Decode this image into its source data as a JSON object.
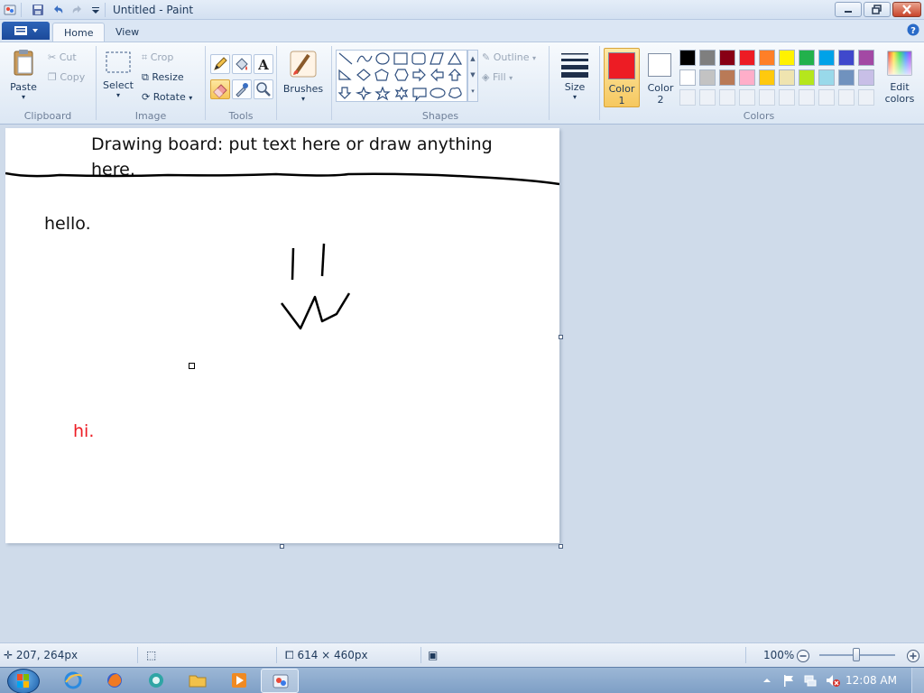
{
  "window": {
    "title": "Untitled - Paint"
  },
  "tabs": [
    {
      "label": "Home",
      "active": true
    },
    {
      "label": "View",
      "active": false
    }
  ],
  "ribbon": {
    "clipboard": {
      "label": "Clipboard",
      "paste": "Paste",
      "cut": "Cut",
      "copy": "Copy"
    },
    "image": {
      "label": "Image",
      "select": "Select",
      "crop": "Crop",
      "resize": "Resize",
      "rotate": "Rotate"
    },
    "tools": {
      "label": "Tools",
      "items": [
        "pencil-icon",
        "fill-icon",
        "text-icon",
        "eraser-icon",
        "color-picker-icon",
        "magnifier-icon"
      ],
      "active": "eraser-icon"
    },
    "brushes": {
      "label": "Brushes"
    },
    "shapes": {
      "label": "Shapes",
      "outline": "Outline",
      "fill": "Fill"
    },
    "size": {
      "label": "Size"
    },
    "colors": {
      "label": "Colors",
      "color1_label_line1": "Color",
      "color1_label_line2": "1",
      "color2_label_line1": "Color",
      "color2_label_line2": "2",
      "color1": "#ed1c24",
      "color2": "#ffffff",
      "edit_line1": "Edit",
      "edit_line2": "colors",
      "palette_row1": [
        "#000000",
        "#7f7f7f",
        "#880015",
        "#ed1c24",
        "#ff7f27",
        "#fff200",
        "#22b14c",
        "#00a2e8",
        "#3f48cc",
        "#a349a4"
      ],
      "palette_row2": [
        "#ffffff",
        "#c3c3c3",
        "#b97a57",
        "#ffaec9",
        "#ffc90e",
        "#efe4b0",
        "#b5e61d",
        "#99d9ea",
        "#7092be",
        "#c8bfe7"
      ]
    }
  },
  "canvas": {
    "header_line1": "Drawing board: put text here or draw anything",
    "header_line2": "here.",
    "text_hello": "hello.",
    "text_hi": "hi.",
    "text_hi_color": "#ed1c24"
  },
  "status": {
    "cursor_pos": "207, 264px",
    "image_size": "614 × 460px",
    "zoom": "100%"
  },
  "taskbar": {
    "clock": "12:08 AM"
  }
}
